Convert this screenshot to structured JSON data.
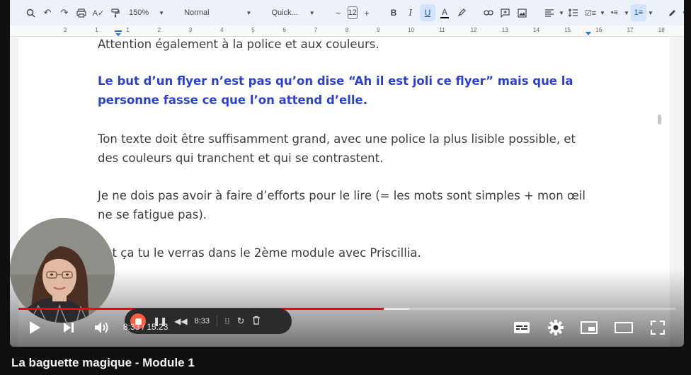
{
  "toolbar": {
    "zoom": "150%",
    "style": "Normal",
    "font": "Quick...",
    "font_size": "12"
  },
  "ruler": {
    "numbers": [
      "2",
      "1",
      "1",
      "2",
      "3",
      "4",
      "5",
      "6",
      "7",
      "8",
      "9",
      "10",
      "11",
      "12",
      "13",
      "14",
      "15",
      "16",
      "17",
      "18"
    ]
  },
  "document": {
    "line1": "Attention également à la police et aux couleurs.",
    "paragraph_highlight": "Le but d’un flyer n’est pas qu’on dise “Ah il est joli ce flyer” mais que la personne fasse ce que l’on attend d’elle.",
    "paragraph2": "Ton texte doit être suffisamment grand, avec une police la plus lisible possible, et des couleurs qui tranchent et qui se contrastent.",
    "paragraph3": "Je ne dois pas avoir à faire d’efforts pour le lire (= les mots sont simples + mon œil ne se fatigue pas).",
    "paragraph4": "out ça tu le verras dans le 2ème module avec Priscillia."
  },
  "player": {
    "current_time": "8:33",
    "duration": "15:23",
    "time_display": "8:33 / 15:23",
    "progress_fraction": 0.556,
    "buffered_fraction": 0.595,
    "accent_color": "#ff0000"
  },
  "recorder": {
    "elapsed": "8:33"
  },
  "video": {
    "title": "La baguette magique - Module 1"
  }
}
